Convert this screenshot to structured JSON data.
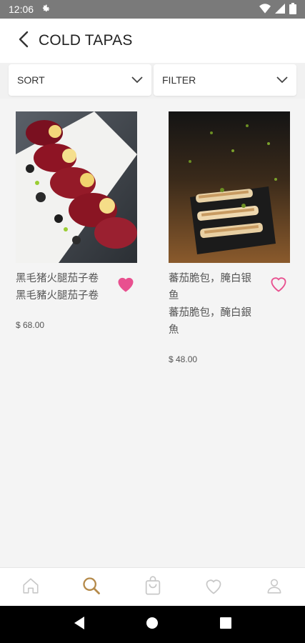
{
  "status_bar": {
    "time": "12:06"
  },
  "header": {
    "title": "COLD TAPAS"
  },
  "controls": {
    "sort_label": "SORT",
    "filter_label": "FILTER"
  },
  "products": [
    {
      "name_simplified": "黑毛猪火腿茄子卷",
      "name_traditional": "黑毛豬火腿茄子卷",
      "price": "$ 68.00",
      "favorite": true,
      "heart_color": "#e8508f"
    },
    {
      "name_simplified": "蕃茄脆包，腌白银鱼",
      "name_traditional": "蕃茄脆包，醃白銀魚",
      "price": "$ 48.00",
      "favorite": false,
      "heart_color": "#e8508f"
    }
  ],
  "bottom_nav": {
    "items": [
      "home-icon",
      "search-icon",
      "cart-icon",
      "favorites-icon",
      "profile-icon"
    ],
    "active": "search-icon",
    "active_color": "#b58a4a",
    "inactive_color": "#c8c8c8"
  }
}
